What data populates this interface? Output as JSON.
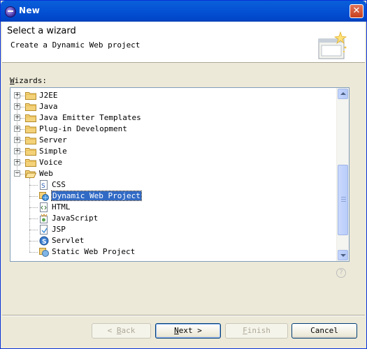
{
  "window": {
    "title": "New",
    "close_label": "✕"
  },
  "header": {
    "title": "Select a wizard",
    "description": "Create a Dynamic Web project"
  },
  "wizards": {
    "label_accel": "W",
    "label_rest": "izards:",
    "tree": [
      {
        "label": "J2EE",
        "kind": "folder",
        "expanded": false
      },
      {
        "label": "Java",
        "kind": "folder",
        "expanded": false
      },
      {
        "label": "Java Emitter Templates",
        "kind": "folder",
        "expanded": false
      },
      {
        "label": "Plug-in Development",
        "kind": "folder",
        "expanded": false
      },
      {
        "label": "Server",
        "kind": "folder",
        "expanded": false
      },
      {
        "label": "Simple",
        "kind": "folder",
        "expanded": false
      },
      {
        "label": "Voice",
        "kind": "folder",
        "expanded": false
      },
      {
        "label": "Web",
        "kind": "folder",
        "expanded": true
      },
      {
        "label": "CSS",
        "kind": "leaf",
        "icon": "css-file-icon"
      },
      {
        "label": "Dynamic Web Project",
        "kind": "leaf",
        "icon": "dynamic-web-project-icon",
        "selected": true
      },
      {
        "label": "HTML",
        "kind": "leaf",
        "icon": "html-file-icon"
      },
      {
        "label": "JavaScript",
        "kind": "leaf",
        "icon": "javascript-file-icon"
      },
      {
        "label": "JSP",
        "kind": "leaf",
        "icon": "jsp-file-icon"
      },
      {
        "label": "Servlet",
        "kind": "leaf",
        "icon": "servlet-icon"
      },
      {
        "label": "Static Web Project",
        "kind": "leaf",
        "icon": "static-web-project-icon"
      }
    ]
  },
  "help": {
    "label": "?"
  },
  "buttons": {
    "back": {
      "arrow": "< ",
      "accel": "B",
      "rest": "ack",
      "enabled": false
    },
    "next": {
      "accel": "N",
      "rest": "ext >",
      "enabled": true
    },
    "finish": {
      "accel": "F",
      "rest": "inish",
      "enabled": false
    },
    "cancel": {
      "label": "Cancel",
      "enabled": true
    }
  },
  "colors": {
    "titlebar": "#0054e3",
    "selection": "#316ac5",
    "tree_border": "#7f9db9"
  }
}
